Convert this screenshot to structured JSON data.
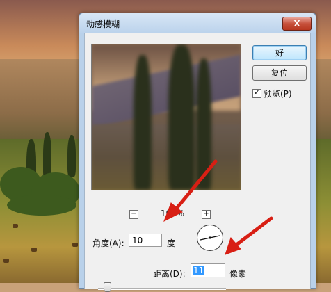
{
  "window": {
    "title": "动感模糊",
    "close_glyph": "X"
  },
  "buttons": {
    "ok_label": "好",
    "reset_label": "复位"
  },
  "preview": {
    "checkbox_label": "预览(P)",
    "checked": true,
    "check_glyph": "✓",
    "zoom_level": "100%",
    "zoom_out_glyph": "−",
    "zoom_in_glyph": "+"
  },
  "angle": {
    "label": "角度(A):",
    "value": "10",
    "unit": "度"
  },
  "distance": {
    "label": "距离(D):",
    "value": "11",
    "unit": "像素"
  },
  "colors": {
    "annotation_arrow": "#d81f14",
    "selection_highlight": "#3399ff"
  },
  "icons": {
    "angle_dial": "angle-dial-icon",
    "annotation": "red-arrow-icon"
  }
}
